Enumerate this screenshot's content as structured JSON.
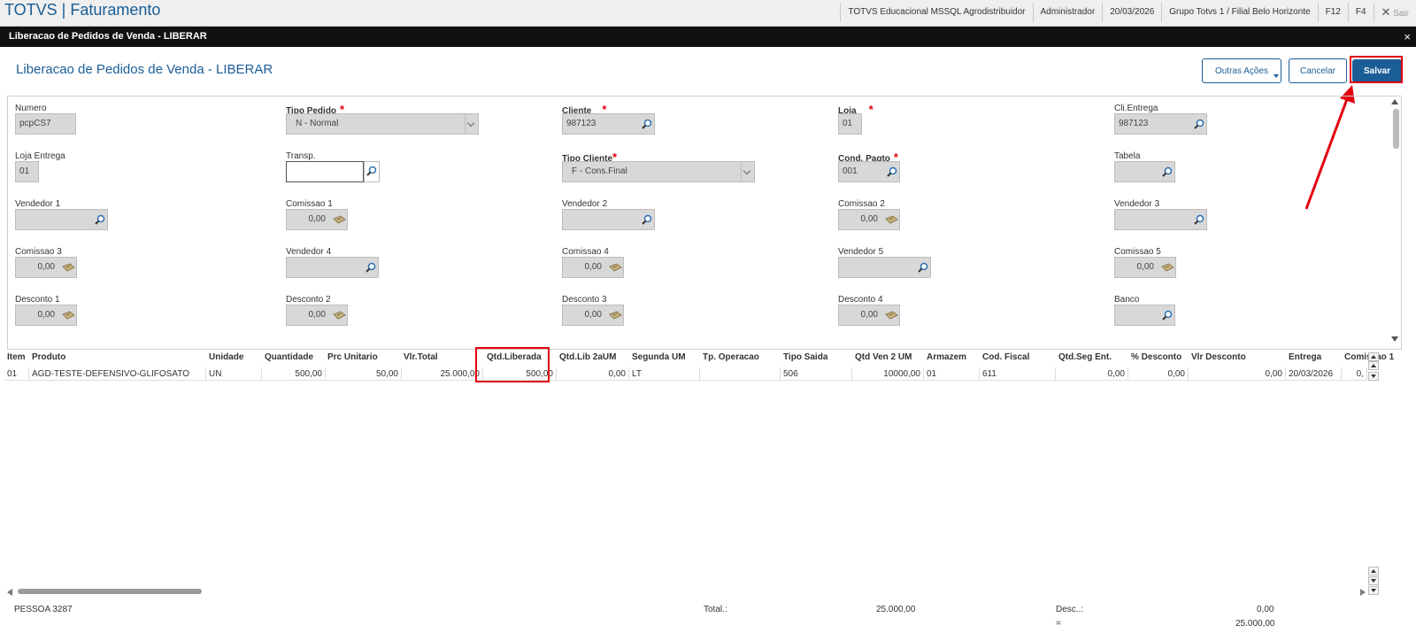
{
  "app": {
    "title": "TOTVS | Faturamento"
  },
  "topbar": {
    "items": [
      "TOTVS Educacional MSSQL Agrodistribuidor",
      "Administrador",
      "20/03/2026",
      "Grupo Totvs 1 / Filial Belo Horizonte",
      "F12",
      "F4"
    ],
    "exit_label": "Sair"
  },
  "window": {
    "title": "Liberacao de Pedidos de Venda - LIBERAR",
    "close": "×"
  },
  "page": {
    "title": "Liberacao de Pedidos de Venda - LIBERAR"
  },
  "actions": {
    "outras": "Outras Ações",
    "cancelar": "Cancelar",
    "salvar": "Salvar"
  },
  "form": {
    "numero": {
      "label": "Numero",
      "value": "pcpCS7"
    },
    "tipo_pedido": {
      "label": "Tipo Pedido",
      "value": "N - Normal"
    },
    "cliente": {
      "label": "Cliente",
      "value": "987123"
    },
    "loja": {
      "label": "Loja",
      "value": "01"
    },
    "cli_entrega": {
      "label": "Cli.Entrega",
      "value": "987123"
    },
    "loja_entrega": {
      "label": "Loja Entrega",
      "value": "01"
    },
    "transp": {
      "label": "Transp.",
      "value": ""
    },
    "tipo_cliente": {
      "label": "Tipo Cliente",
      "value": "F - Cons.Final"
    },
    "cond_pagto": {
      "label": "Cond. Pagto",
      "value": "001"
    },
    "tabela": {
      "label": "Tabela",
      "value": ""
    },
    "vendedor1": {
      "label": "Vendedor 1",
      "value": ""
    },
    "comissao1": {
      "label": "Comissao 1",
      "value": "0,00"
    },
    "vendedor2": {
      "label": "Vendedor 2",
      "value": ""
    },
    "comissao2": {
      "label": "Comissao 2",
      "value": "0,00"
    },
    "vendedor3": {
      "label": "Vendedor 3",
      "value": ""
    },
    "comissao3": {
      "label": "Comissao 3",
      "value": "0,00"
    },
    "vendedor4": {
      "label": "Vendedor 4",
      "value": ""
    },
    "comissao4": {
      "label": "Comissao 4",
      "value": "0,00"
    },
    "vendedor5": {
      "label": "Vendedor 5",
      "value": ""
    },
    "comissao5": {
      "label": "Comissao 5",
      "value": "0,00"
    },
    "desconto1": {
      "label": "Desconto 1",
      "value": "0,00"
    },
    "desconto2": {
      "label": "Desconto 2",
      "value": "0,00"
    },
    "desconto3": {
      "label": "Desconto 3",
      "value": "0,00"
    },
    "desconto4": {
      "label": "Desconto 4",
      "value": "0,00"
    },
    "banco": {
      "label": "Banco",
      "value": ""
    }
  },
  "grid": {
    "columns": [
      "Item",
      "Produto",
      "Unidade",
      "Quantidade",
      "Prc Unitario",
      "Vlr.Total",
      "Qtd.Liberada",
      "Qtd.Lib 2aUM",
      "Segunda UM",
      "Tp. Operacao",
      "Tipo Saida",
      "Qtd Ven 2 UM",
      "Armazem",
      "Cod. Fiscal",
      "Qtd.Seg Ent.",
      "% Desconto",
      "Vlr Desconto",
      "Entrega",
      "Comissao 1"
    ],
    "rows": [
      [
        "01",
        "AGD-TESTE-DEFENSIVO-GLIFOSATO",
        "UN",
        "500,00",
        "50,00",
        "25.000,00",
        "500,00",
        "0,00",
        "LT",
        "",
        "506",
        "10000,00",
        "01",
        "611",
        "0,00",
        "0,00",
        "0,00",
        "20/03/2026",
        "0,"
      ]
    ]
  },
  "footer": {
    "pessoa": "PESSOA 3287",
    "total_label": "Total.:",
    "total_value": "25.000,00",
    "desc_label": "Desc..:",
    "desc_value": "0,00",
    "eq_label": "=",
    "eq_value": "25.000,00"
  },
  "colors": {
    "accent": "#1a5d97",
    "highlight": "#e3000f",
    "required": "#e3000f"
  }
}
